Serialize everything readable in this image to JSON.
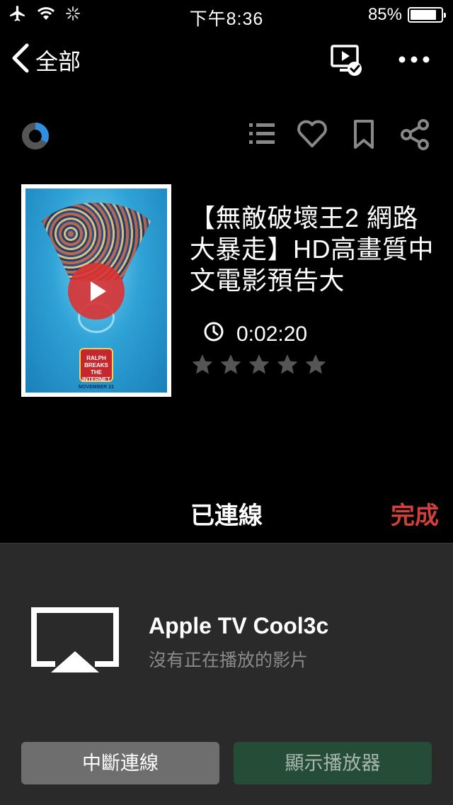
{
  "status_bar": {
    "time": "下午8:36",
    "battery_text": "85%",
    "battery_level": 0.85
  },
  "nav": {
    "back_label": "全部"
  },
  "video": {
    "title": "【無敵破壞王2 網路大暴走】HD高畫質中文電影預告大",
    "duration": "0:02:20",
    "rating": 0,
    "rating_max": 5,
    "poster": {
      "logo_text": "RALPH BREAKS THE INTERNET",
      "date_text": "NOVEMBER 21"
    }
  },
  "connection": {
    "title": "已連線",
    "done_label": "完成",
    "device_name": "Apple TV Cool3c",
    "device_status": "沒有正在播放的影片",
    "disconnect_label": "中斷連線",
    "show_player_label": "顯示播放器"
  },
  "colors": {
    "accent_red": "#d0413a",
    "progress_blue": "#2f8fe0",
    "player_button": "#254c36"
  }
}
